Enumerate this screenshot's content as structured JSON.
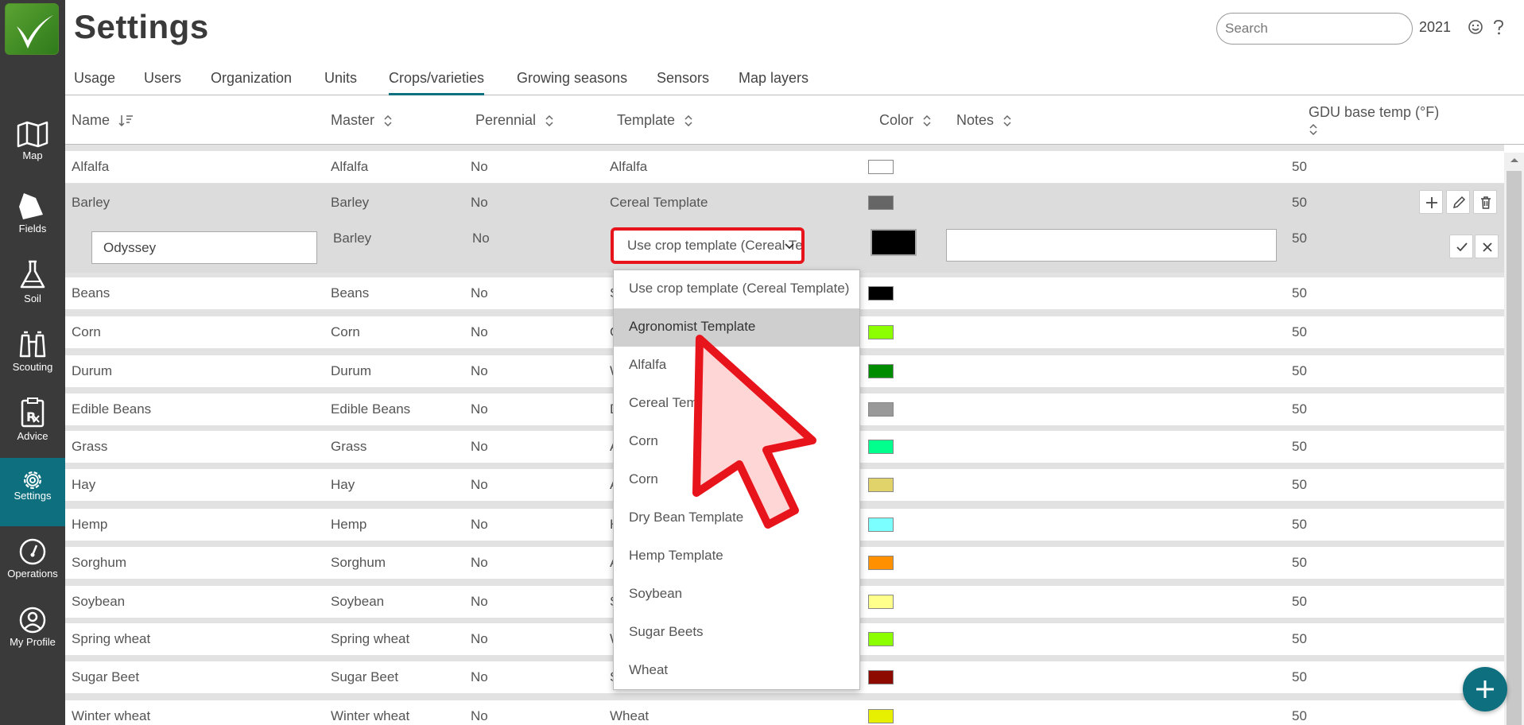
{
  "header": {
    "title": "Settings",
    "search_placeholder": "Search",
    "year": "2021"
  },
  "sidebar": {
    "items": [
      {
        "label": "Map",
        "icon": "map-icon"
      },
      {
        "label": "Fields",
        "icon": "fields-icon"
      },
      {
        "label": "Soil",
        "icon": "flask-icon"
      },
      {
        "label": "Scouting",
        "icon": "binoculars-icon"
      },
      {
        "label": "Advice",
        "icon": "rx-clipboard-icon"
      },
      {
        "label": "Settings",
        "icon": "gear-icon",
        "active": true
      },
      {
        "label": "Operations",
        "icon": "gauge-icon"
      },
      {
        "label": "My Profile",
        "icon": "user-icon"
      }
    ]
  },
  "tabs": [
    {
      "label": "Usage"
    },
    {
      "label": "Users"
    },
    {
      "label": "Organization"
    },
    {
      "label": "Units"
    },
    {
      "label": "Crops/varieties",
      "active": true
    },
    {
      "label": "Growing seasons"
    },
    {
      "label": "Sensors"
    },
    {
      "label": "Map layers"
    }
  ],
  "columns": {
    "name": "Name",
    "master": "Master",
    "perennial": "Perennial",
    "template": "Template",
    "color": "Color",
    "notes": "Notes",
    "gdu": "GDU base temp (°F)"
  },
  "rows_before": [
    {
      "name": "Alfalfa",
      "master": "Alfalfa",
      "perennial": "No",
      "template": "Alfalfa",
      "color": "#ffffff",
      "gdu": "50"
    },
    {
      "name": "Barley",
      "master": "Barley",
      "perennial": "No",
      "template": "Cereal Template",
      "color": "#666666",
      "gdu": "50"
    }
  ],
  "edit_row": {
    "name_value": "Odyssey",
    "master": "Barley",
    "perennial": "No",
    "template_value": "Use crop template (Cereal Temp",
    "color": "#000000",
    "notes_value": "",
    "gdu": "50"
  },
  "rows_after": [
    {
      "name": "Beans",
      "master": "Beans",
      "perennial": "No",
      "template": "S",
      "color": "#000000",
      "gdu": "50"
    },
    {
      "name": "Corn",
      "master": "Corn",
      "perennial": "No",
      "template": "C",
      "color": "#8cff00",
      "gdu": "50"
    },
    {
      "name": "Durum",
      "master": "Durum",
      "perennial": "No",
      "template": "W",
      "color": "#008c00",
      "gdu": "50"
    },
    {
      "name": "Edible Beans",
      "master": "Edible Beans",
      "perennial": "No",
      "template": "D",
      "color": "#999999",
      "gdu": "50"
    },
    {
      "name": "Grass",
      "master": "Grass",
      "perennial": "No",
      "template": "A",
      "color": "#00ff8c",
      "gdu": "50"
    },
    {
      "name": "Hay",
      "master": "Hay",
      "perennial": "No",
      "template": "A",
      "color": "#e2d26a",
      "gdu": "50"
    },
    {
      "name": "Hemp",
      "master": "Hemp",
      "perennial": "No",
      "template": "H",
      "color": "#7cffff",
      "gdu": "50"
    },
    {
      "name": "Sorghum",
      "master": "Sorghum",
      "perennial": "No",
      "template": "A",
      "color": "#ff9000",
      "gdu": "50"
    },
    {
      "name": "Soybean",
      "master": "Soybean",
      "perennial": "No",
      "template": "S",
      "color": "#ffff8c",
      "gdu": "50"
    },
    {
      "name": "Spring wheat",
      "master": "Spring wheat",
      "perennial": "No",
      "template": "W",
      "color": "#8cff00",
      "gdu": "50"
    },
    {
      "name": "Sugar Beet",
      "master": "Sugar Beet",
      "perennial": "No",
      "template": "S",
      "color": "#8c0a00",
      "gdu": "50"
    },
    {
      "name": "Winter wheat",
      "master": "Winter wheat",
      "perennial": "No",
      "template": "Wheat",
      "color": "#e6f000",
      "gdu": "50"
    }
  ],
  "dropdown": {
    "options": [
      "Use crop template (Cereal Template)",
      "Agronomist Template",
      "Alfalfa",
      "Cereal Template",
      "Corn",
      "Corn",
      "Dry Bean Template",
      "Hemp Template",
      "Soybean",
      "Sugar Beets",
      "Wheat"
    ],
    "highlighted_index": 1
  },
  "colors": {
    "sidebar_bg": "#3a3a3a",
    "accent": "#0e6f7e",
    "highlight_border": "#e8141c"
  }
}
